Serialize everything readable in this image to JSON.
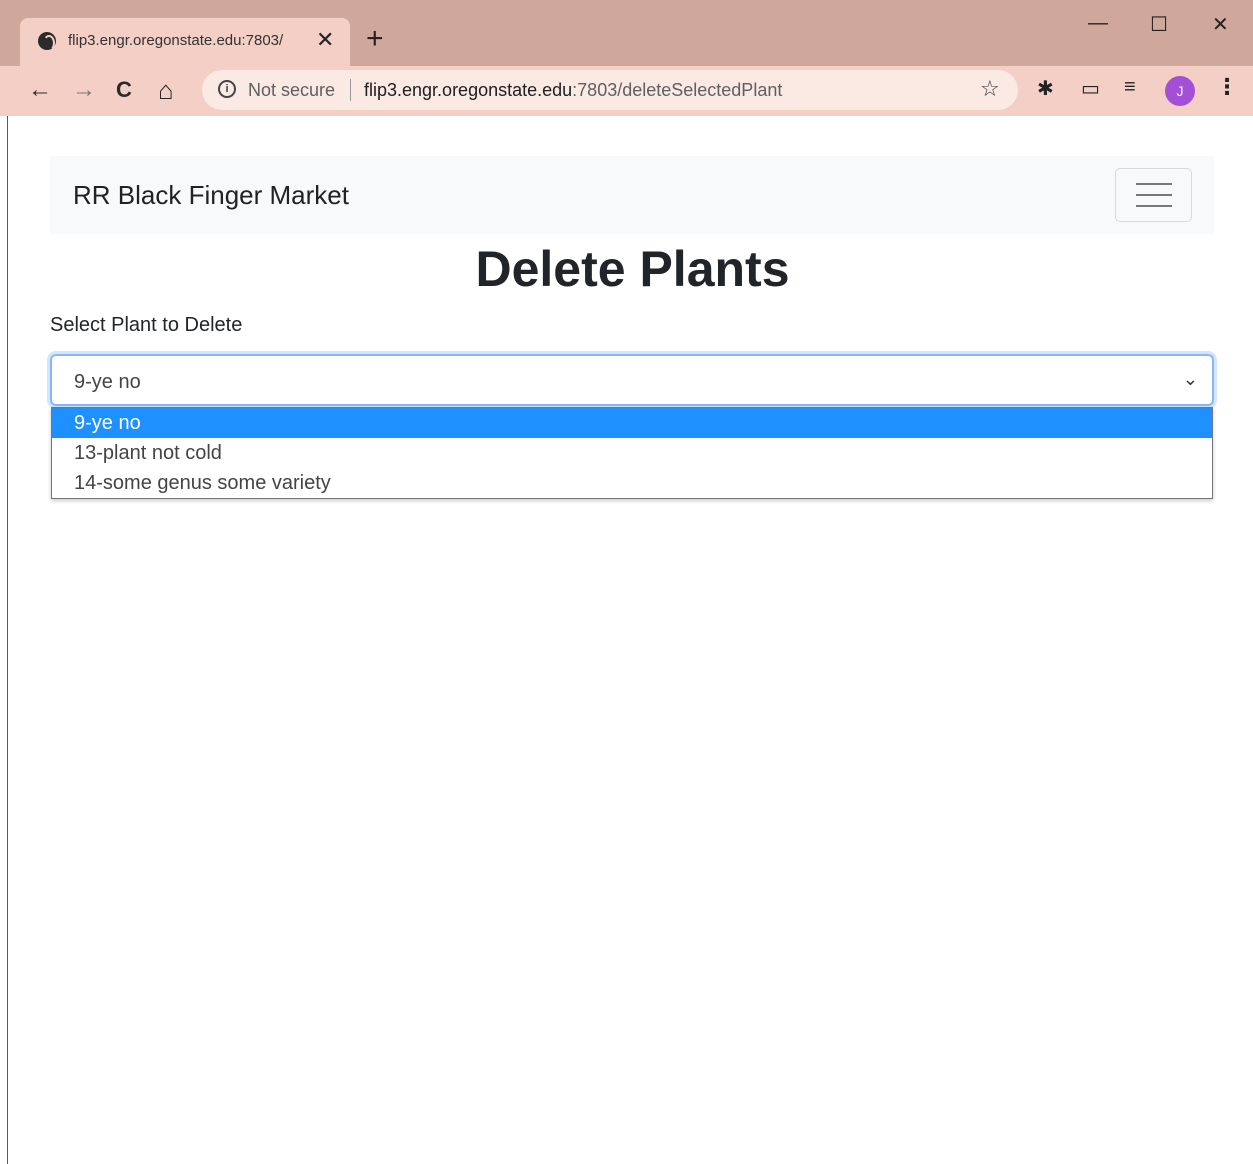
{
  "browser": {
    "tab_title": "flip3.engr.oregonstate.edu:7803/",
    "tab_close": "✕",
    "new_tab": "+",
    "window_controls": {
      "minimize": "—",
      "maximize": "☐",
      "close": "✕"
    },
    "nav": {
      "back": "←",
      "forward": "→",
      "reload": "C",
      "home": "⌂"
    },
    "security_text": "Not secure",
    "url_host": "flip3.engr.oregonstate.edu",
    "url_path": ":7803/deleteSelectedPlant",
    "avatar_letter": "J",
    "icons": [
      "globe-icon",
      "info-icon",
      "star-icon",
      "puzzle-icon",
      "cast-icon",
      "queue-icon",
      "kebab-menu-icon"
    ]
  },
  "navbar": {
    "brand": "RR Black Finger Market"
  },
  "page": {
    "title": "Delete Plants",
    "select_label": "Select Plant to Delete",
    "selected_value": "9-ye no",
    "options": [
      "9-ye no",
      "13-plant not cold",
      "14-some genus some variety"
    ]
  },
  "colors": {
    "chrome": "#cfa79b",
    "toolbar": "#f4cfc5",
    "avatar": "#a34fd6",
    "option_highlight": "#1e90ff",
    "select_focus": "#86b7fe"
  }
}
